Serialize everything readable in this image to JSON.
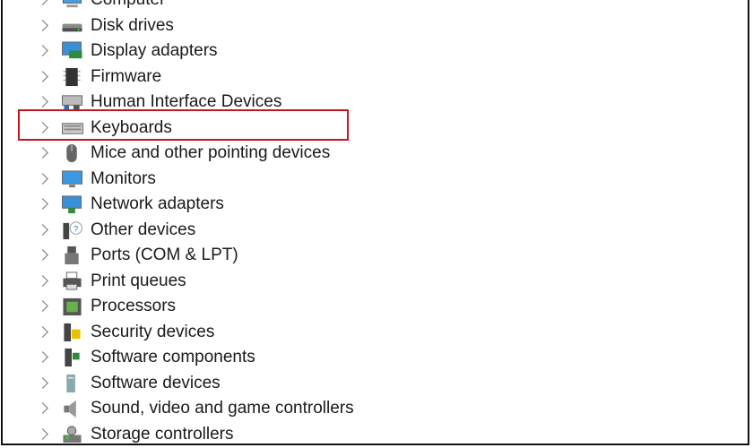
{
  "tree": {
    "items": [
      {
        "label": "Computer",
        "icon": "computer-icon"
      },
      {
        "label": "Disk drives",
        "icon": "disk-drive-icon"
      },
      {
        "label": "Display adapters",
        "icon": "display-adapter-icon"
      },
      {
        "label": "Firmware",
        "icon": "firmware-chip-icon"
      },
      {
        "label": "Human Interface Devices",
        "icon": "hid-icon"
      },
      {
        "label": "Keyboards",
        "icon": "keyboard-icon"
      },
      {
        "label": "Mice and other pointing devices",
        "icon": "mouse-icon"
      },
      {
        "label": "Monitors",
        "icon": "monitor-icon"
      },
      {
        "label": "Network adapters",
        "icon": "network-adapter-icon"
      },
      {
        "label": "Other devices",
        "icon": "unknown-device-icon"
      },
      {
        "label": "Ports (COM & LPT)",
        "icon": "port-icon"
      },
      {
        "label": "Print queues",
        "icon": "printer-icon"
      },
      {
        "label": "Processors",
        "icon": "processor-icon"
      },
      {
        "label": "Security devices",
        "icon": "security-device-icon"
      },
      {
        "label": "Software components",
        "icon": "software-component-icon"
      },
      {
        "label": "Software devices",
        "icon": "software-device-icon"
      },
      {
        "label": "Sound, video and game controllers",
        "icon": "speaker-icon"
      },
      {
        "label": "Storage controllers",
        "icon": "storage-controller-icon"
      }
    ],
    "highlighted_index": 5,
    "highlight_color": "#c8161d"
  }
}
